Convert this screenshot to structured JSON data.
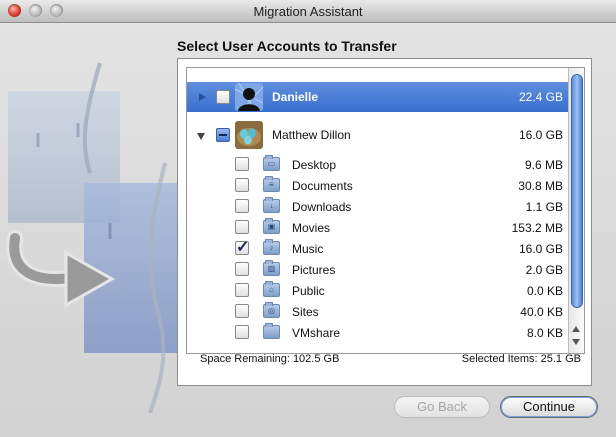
{
  "window": {
    "title": "Migration Assistant",
    "heading": "Select User Accounts to Transfer"
  },
  "accounts": [
    {
      "name": "Danielle",
      "size": "22.4 GB",
      "state": "unchecked",
      "expanded": false,
      "selected": true,
      "avatar": "silhouette-avatar"
    },
    {
      "name": "Matthew Dillon",
      "size": "16.0 GB",
      "state": "mixed",
      "expanded": true,
      "selected": false,
      "avatar": "bird-eggs-avatar"
    }
  ],
  "folders": [
    {
      "name": "Desktop",
      "size": "9.6 MB",
      "checked": false,
      "icon": "desktop-folder-icon",
      "glyph": "▭"
    },
    {
      "name": "Documents",
      "size": "30.8 MB",
      "checked": false,
      "icon": "documents-folder-icon",
      "glyph": "≡"
    },
    {
      "name": "Downloads",
      "size": "1.1 GB",
      "checked": false,
      "icon": "downloads-folder-icon",
      "glyph": "↓"
    },
    {
      "name": "Movies",
      "size": "153.2 MB",
      "checked": false,
      "icon": "movies-folder-icon",
      "glyph": "▣"
    },
    {
      "name": "Music",
      "size": "16.0 GB",
      "checked": true,
      "icon": "music-folder-icon",
      "glyph": "♪"
    },
    {
      "name": "Pictures",
      "size": "2.0 GB",
      "checked": false,
      "icon": "pictures-folder-icon",
      "glyph": "▨"
    },
    {
      "name": "Public",
      "size": "0.0 KB",
      "checked": false,
      "icon": "public-folder-icon",
      "glyph": "⌂"
    },
    {
      "name": "Sites",
      "size": "40.0 KB",
      "checked": false,
      "icon": "sites-folder-icon",
      "glyph": "◎"
    },
    {
      "name": "VMshare",
      "size": "8.0 KB",
      "checked": false,
      "icon": "vmshare-folder-icon",
      "glyph": ""
    }
  ],
  "status": {
    "space_remaining": "Space Remaining:  102.5 GB",
    "selected_items": "Selected Items: 25.1 GB"
  },
  "buttons": {
    "back": "Go Back",
    "continue": "Continue"
  },
  "colors": {
    "selection": "#3a6fd0",
    "accent": "#5c8ed9"
  }
}
